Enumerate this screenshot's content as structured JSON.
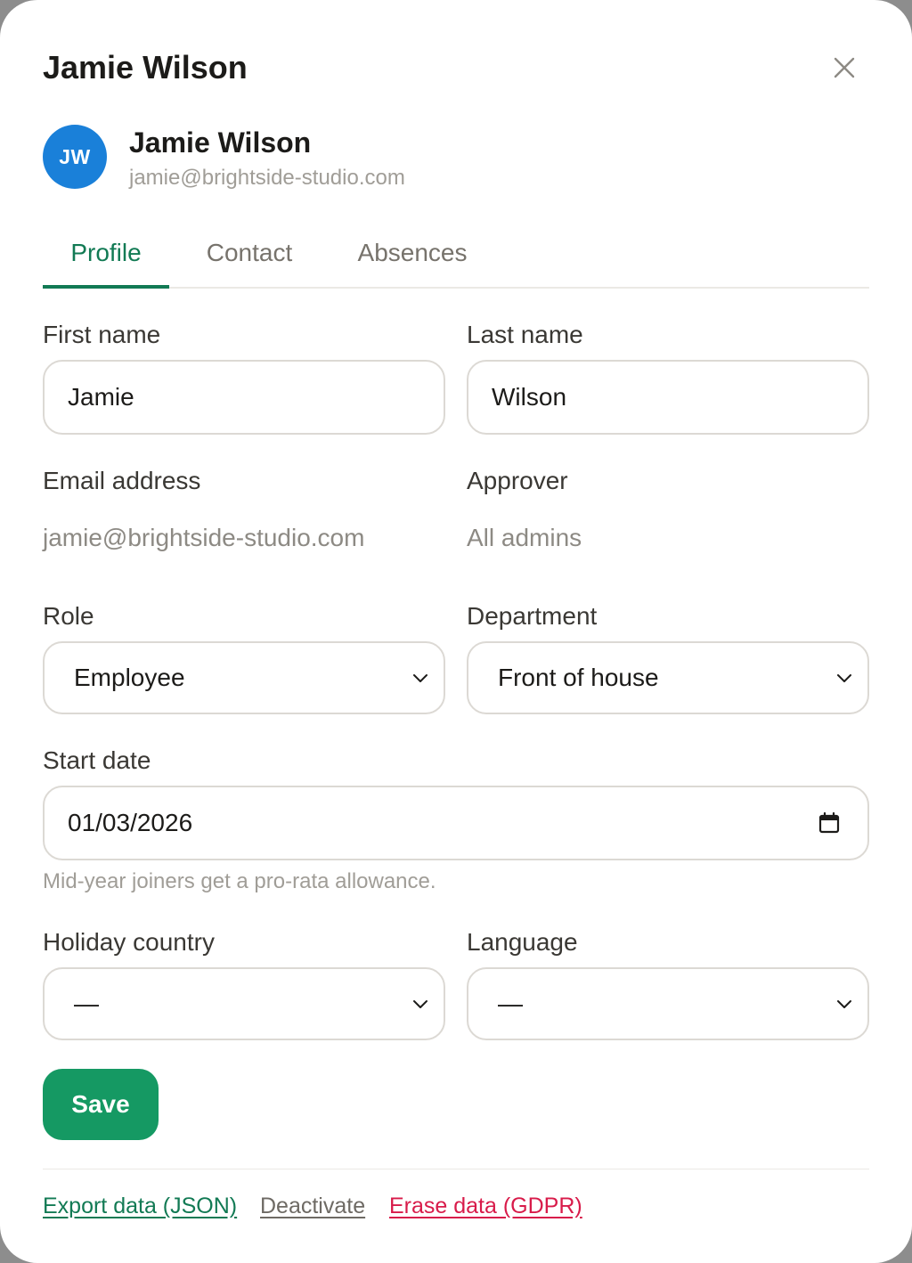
{
  "modal": {
    "title": "Jamie Wilson",
    "close_icon": "close-icon"
  },
  "user": {
    "initials": "JW",
    "name": "Jamie Wilson",
    "email": "jamie@brightside-studio.com",
    "avatar_color": "#1a80d9"
  },
  "tabs": [
    {
      "label": "Profile",
      "active": true
    },
    {
      "label": "Contact",
      "active": false
    },
    {
      "label": "Absences",
      "active": false
    }
  ],
  "form": {
    "first_name": {
      "label": "First name",
      "value": "Jamie"
    },
    "last_name": {
      "label": "Last name",
      "value": "Wilson"
    },
    "email": {
      "label": "Email address",
      "value": "jamie@brightside-studio.com"
    },
    "approver": {
      "label": "Approver",
      "value": "All admins"
    },
    "role": {
      "label": "Role",
      "value": "Employee"
    },
    "department": {
      "label": "Department",
      "value": "Front of house"
    },
    "start_date": {
      "label": "Start date",
      "value": "01/03/2026",
      "hint": "Mid-year joiners get a pro-rata allowance."
    },
    "holiday_country": {
      "label": "Holiday country",
      "value": "—"
    },
    "language": {
      "label": "Language",
      "value": "—"
    }
  },
  "actions": {
    "save_label": "Save",
    "save_color": "#159963"
  },
  "footer": {
    "export_label": "Export data (JSON)",
    "deactivate_label": "Deactivate",
    "erase_label": "Erase data (GDPR)",
    "accent_color": "#127a54",
    "danger_color": "#d81b4a"
  }
}
